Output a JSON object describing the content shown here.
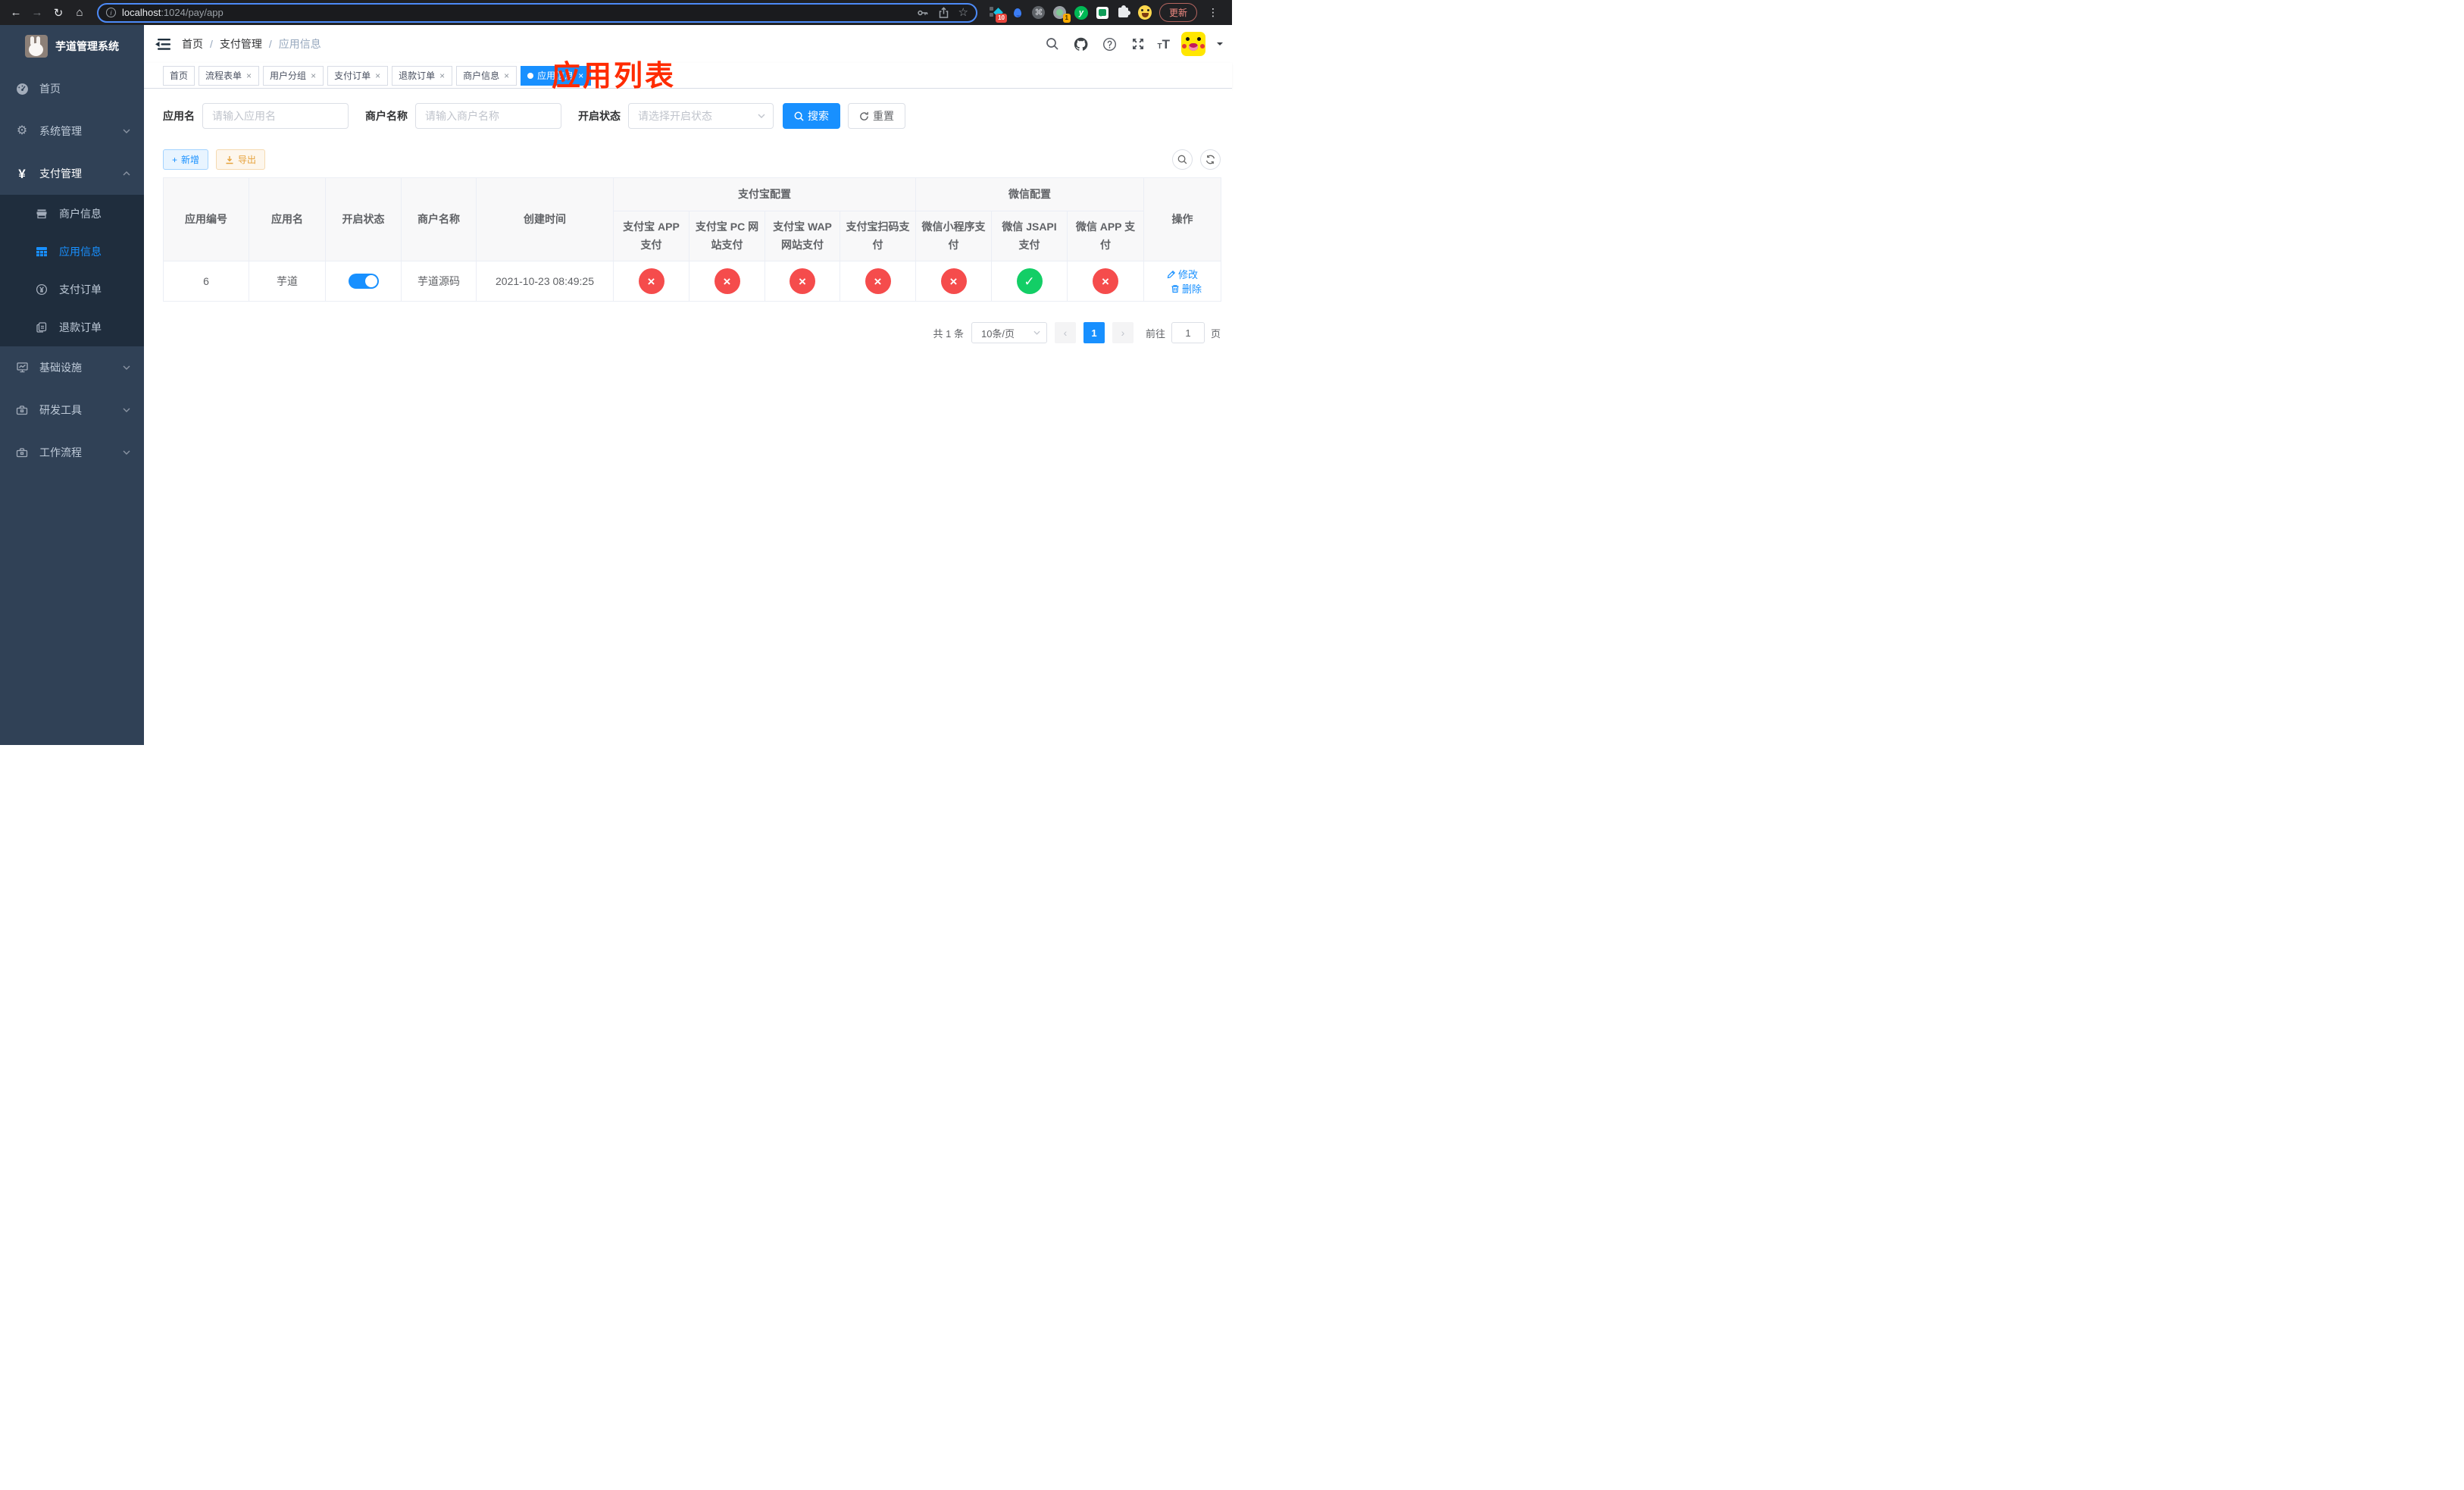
{
  "browser": {
    "url_host": "localhost",
    "url_path": ":1024/pay/app",
    "update_label": "更新",
    "ext_badge_blocked": "10",
    "ext_badge_count": "1",
    "ext_y_letter": "y"
  },
  "icons": {
    "back": "←",
    "forward": "→",
    "reload": "↻",
    "home": "⌂",
    "info": "i",
    "star": "☆",
    "command": "⌘",
    "more": "⋮",
    "caret": "",
    "gear": "⚙",
    "yen": "¥",
    "close": "×",
    "dot": "",
    "plus": "+",
    "question": "?",
    "check": "✓",
    "cross": "×",
    "prev": "‹",
    "next": "›",
    "small_t": "T",
    "big_t": "T"
  },
  "sidebar": {
    "app_title": "芋道管理系统",
    "menu": [
      {
        "label": "首页"
      },
      {
        "label": "系统管理"
      },
      {
        "label": "支付管理"
      },
      {
        "label": "基础设施"
      },
      {
        "label": "研发工具"
      },
      {
        "label": "工作流程"
      }
    ],
    "submenu": [
      {
        "label": "商户信息"
      },
      {
        "label": "应用信息"
      },
      {
        "label": "支付订单"
      },
      {
        "label": "退款订单"
      }
    ]
  },
  "navbar": {
    "breadcrumb": [
      "首页",
      "支付管理",
      "应用信息"
    ],
    "separator": "/",
    "annotation": "应用列表"
  },
  "tabs": [
    {
      "label": "首页"
    },
    {
      "label": "流程表单"
    },
    {
      "label": "用户分组"
    },
    {
      "label": "支付订单"
    },
    {
      "label": "退款订单"
    },
    {
      "label": "商户信息"
    },
    {
      "label": "应用信息"
    }
  ],
  "filters": {
    "app_name_label": "应用名",
    "app_name_placeholder": "请输入应用名",
    "merchant_label": "商户名称",
    "merchant_placeholder": "请输入商户名称",
    "status_label": "开启状态",
    "status_placeholder": "请选择开启状态",
    "search_label": "搜索",
    "reset_label": "重置"
  },
  "toolbar": {
    "add_label": "新增",
    "export_label": "导出"
  },
  "table": {
    "simple_cols": [
      "应用编号",
      "应用名",
      "开启状态",
      "商户名称",
      "创建时间"
    ],
    "group_alipay": "支付宝配置",
    "group_wechat": "微信配置",
    "alipay_cols": [
      "支付宝 APP 支付",
      "支付宝 PC 网站支付",
      "支付宝 WAP 网站支付",
      "支付宝扫码支付"
    ],
    "wechat_cols": [
      "微信小程序支付",
      "微信 JSAPI 支付",
      "微信 APP 支付"
    ],
    "op_col": "操作",
    "row": {
      "id": "6",
      "name": "芋道",
      "enabled": true,
      "merchant": "芋道源码",
      "created": "2021-10-23 08:49:25",
      "statuses": [
        false,
        false,
        false,
        false,
        false,
        true,
        false
      ],
      "edit_label": "修改",
      "delete_label": "删除"
    }
  },
  "pagination": {
    "total": "共 1 条",
    "page_size": "10条/页",
    "page": "1",
    "goto_label": "前往",
    "goto_value": "1",
    "page_unit": "页"
  }
}
